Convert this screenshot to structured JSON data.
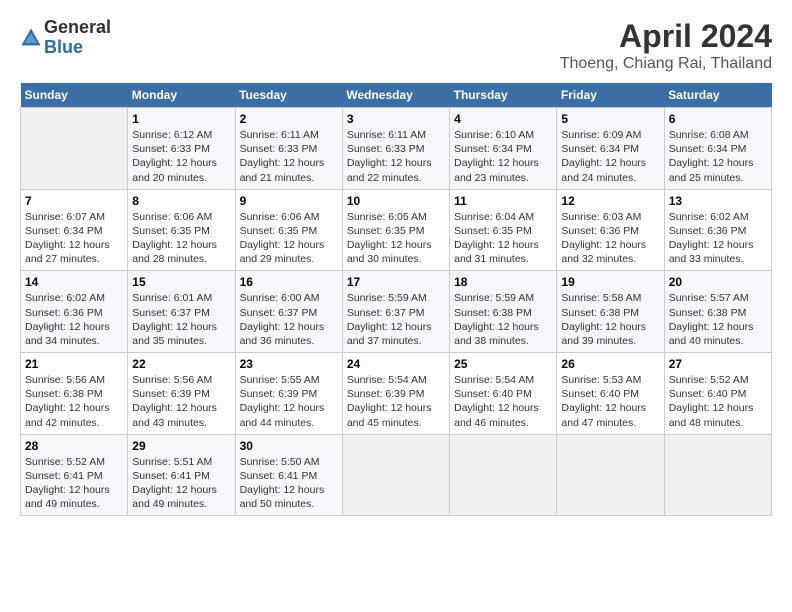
{
  "header": {
    "logo_line1": "General",
    "logo_line2": "Blue",
    "main_title": "April 2024",
    "subtitle": "Thoeng, Chiang Rai, Thailand"
  },
  "columns": [
    "Sunday",
    "Monday",
    "Tuesday",
    "Wednesday",
    "Thursday",
    "Friday",
    "Saturday"
  ],
  "weeks": [
    [
      {
        "day": "",
        "sunrise": "",
        "sunset": "",
        "daylight": ""
      },
      {
        "day": "1",
        "sunrise": "Sunrise: 6:12 AM",
        "sunset": "Sunset: 6:33 PM",
        "daylight": "Daylight: 12 hours and 20 minutes."
      },
      {
        "day": "2",
        "sunrise": "Sunrise: 6:11 AM",
        "sunset": "Sunset: 6:33 PM",
        "daylight": "Daylight: 12 hours and 21 minutes."
      },
      {
        "day": "3",
        "sunrise": "Sunrise: 6:11 AM",
        "sunset": "Sunset: 6:33 PM",
        "daylight": "Daylight: 12 hours and 22 minutes."
      },
      {
        "day": "4",
        "sunrise": "Sunrise: 6:10 AM",
        "sunset": "Sunset: 6:34 PM",
        "daylight": "Daylight: 12 hours and 23 minutes."
      },
      {
        "day": "5",
        "sunrise": "Sunrise: 6:09 AM",
        "sunset": "Sunset: 6:34 PM",
        "daylight": "Daylight: 12 hours and 24 minutes."
      },
      {
        "day": "6",
        "sunrise": "Sunrise: 6:08 AM",
        "sunset": "Sunset: 6:34 PM",
        "daylight": "Daylight: 12 hours and 25 minutes."
      }
    ],
    [
      {
        "day": "7",
        "sunrise": "Sunrise: 6:07 AM",
        "sunset": "Sunset: 6:34 PM",
        "daylight": "Daylight: 12 hours and 27 minutes."
      },
      {
        "day": "8",
        "sunrise": "Sunrise: 6:06 AM",
        "sunset": "Sunset: 6:35 PM",
        "daylight": "Daylight: 12 hours and 28 minutes."
      },
      {
        "day": "9",
        "sunrise": "Sunrise: 6:06 AM",
        "sunset": "Sunset: 6:35 PM",
        "daylight": "Daylight: 12 hours and 29 minutes."
      },
      {
        "day": "10",
        "sunrise": "Sunrise: 6:05 AM",
        "sunset": "Sunset: 6:35 PM",
        "daylight": "Daylight: 12 hours and 30 minutes."
      },
      {
        "day": "11",
        "sunrise": "Sunrise: 6:04 AM",
        "sunset": "Sunset: 6:35 PM",
        "daylight": "Daylight: 12 hours and 31 minutes."
      },
      {
        "day": "12",
        "sunrise": "Sunrise: 6:03 AM",
        "sunset": "Sunset: 6:36 PM",
        "daylight": "Daylight: 12 hours and 32 minutes."
      },
      {
        "day": "13",
        "sunrise": "Sunrise: 6:02 AM",
        "sunset": "Sunset: 6:36 PM",
        "daylight": "Daylight: 12 hours and 33 minutes."
      }
    ],
    [
      {
        "day": "14",
        "sunrise": "Sunrise: 6:02 AM",
        "sunset": "Sunset: 6:36 PM",
        "daylight": "Daylight: 12 hours and 34 minutes."
      },
      {
        "day": "15",
        "sunrise": "Sunrise: 6:01 AM",
        "sunset": "Sunset: 6:37 PM",
        "daylight": "Daylight: 12 hours and 35 minutes."
      },
      {
        "day": "16",
        "sunrise": "Sunrise: 6:00 AM",
        "sunset": "Sunset: 6:37 PM",
        "daylight": "Daylight: 12 hours and 36 minutes."
      },
      {
        "day": "17",
        "sunrise": "Sunrise: 5:59 AM",
        "sunset": "Sunset: 6:37 PM",
        "daylight": "Daylight: 12 hours and 37 minutes."
      },
      {
        "day": "18",
        "sunrise": "Sunrise: 5:59 AM",
        "sunset": "Sunset: 6:38 PM",
        "daylight": "Daylight: 12 hours and 38 minutes."
      },
      {
        "day": "19",
        "sunrise": "Sunrise: 5:58 AM",
        "sunset": "Sunset: 6:38 PM",
        "daylight": "Daylight: 12 hours and 39 minutes."
      },
      {
        "day": "20",
        "sunrise": "Sunrise: 5:57 AM",
        "sunset": "Sunset: 6:38 PM",
        "daylight": "Daylight: 12 hours and 40 minutes."
      }
    ],
    [
      {
        "day": "21",
        "sunrise": "Sunrise: 5:56 AM",
        "sunset": "Sunset: 6:38 PM",
        "daylight": "Daylight: 12 hours and 42 minutes."
      },
      {
        "day": "22",
        "sunrise": "Sunrise: 5:56 AM",
        "sunset": "Sunset: 6:39 PM",
        "daylight": "Daylight: 12 hours and 43 minutes."
      },
      {
        "day": "23",
        "sunrise": "Sunrise: 5:55 AM",
        "sunset": "Sunset: 6:39 PM",
        "daylight": "Daylight: 12 hours and 44 minutes."
      },
      {
        "day": "24",
        "sunrise": "Sunrise: 5:54 AM",
        "sunset": "Sunset: 6:39 PM",
        "daylight": "Daylight: 12 hours and 45 minutes."
      },
      {
        "day": "25",
        "sunrise": "Sunrise: 5:54 AM",
        "sunset": "Sunset: 6:40 PM",
        "daylight": "Daylight: 12 hours and 46 minutes."
      },
      {
        "day": "26",
        "sunrise": "Sunrise: 5:53 AM",
        "sunset": "Sunset: 6:40 PM",
        "daylight": "Daylight: 12 hours and 47 minutes."
      },
      {
        "day": "27",
        "sunrise": "Sunrise: 5:52 AM",
        "sunset": "Sunset: 6:40 PM",
        "daylight": "Daylight: 12 hours and 48 minutes."
      }
    ],
    [
      {
        "day": "28",
        "sunrise": "Sunrise: 5:52 AM",
        "sunset": "Sunset: 6:41 PM",
        "daylight": "Daylight: 12 hours and 49 minutes."
      },
      {
        "day": "29",
        "sunrise": "Sunrise: 5:51 AM",
        "sunset": "Sunset: 6:41 PM",
        "daylight": "Daylight: 12 hours and 49 minutes."
      },
      {
        "day": "30",
        "sunrise": "Sunrise: 5:50 AM",
        "sunset": "Sunset: 6:41 PM",
        "daylight": "Daylight: 12 hours and 50 minutes."
      },
      {
        "day": "",
        "sunrise": "",
        "sunset": "",
        "daylight": ""
      },
      {
        "day": "",
        "sunrise": "",
        "sunset": "",
        "daylight": ""
      },
      {
        "day": "",
        "sunrise": "",
        "sunset": "",
        "daylight": ""
      },
      {
        "day": "",
        "sunrise": "",
        "sunset": "",
        "daylight": ""
      }
    ]
  ]
}
